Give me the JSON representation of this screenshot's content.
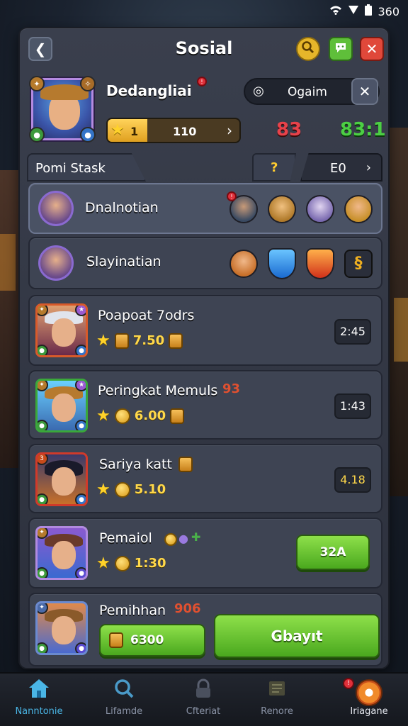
{
  "status_bar": {
    "time": "360",
    "wifi_icon": "wifi-icon",
    "signal_icon": "signal-icon",
    "battery_icon": "battery-icon"
  },
  "header": {
    "title": "Sosial",
    "back_icon": "back-arrow-icon",
    "search_icon": "search-icon",
    "chat_icon": "chat-icon",
    "close_icon": "close-icon"
  },
  "profile": {
    "name": "Dedangliai",
    "level": "1",
    "xp_value": "110",
    "xp_fraction": 0.3,
    "search_pill_text": "Ogaim",
    "stat_red": "83",
    "stat_green": "83:1"
  },
  "tabs": {
    "left": "Pomi Stask",
    "middle": "?",
    "right": "E0"
  },
  "group_rows": [
    {
      "name": "Dnalnotian"
    },
    {
      "name": "Slayinatian"
    }
  ],
  "cards": [
    {
      "name": "Poapoat 7odrs",
      "extra": "",
      "value": "7.50",
      "time": "2:45"
    },
    {
      "name": "Peringkat Memuls",
      "extra": "93",
      "value": "6.00",
      "time": "1:43"
    },
    {
      "name": "Sariya katt",
      "extra": "",
      "value": "5.10",
      "time": "4.18"
    },
    {
      "name": "Pemaiol",
      "extra": "",
      "value": "1:30",
      "button": "32A"
    },
    {
      "name": "Pemihhan",
      "extra": "906",
      "coin_button": "6300",
      "big_button": "Gbayıt"
    }
  ],
  "bottom_nav": [
    {
      "label": "Nanntonie",
      "icon": "home-icon",
      "active": true
    },
    {
      "label": "Lifamde",
      "icon": "search-icon",
      "active": false
    },
    {
      "label": "Cfteriat",
      "icon": "lock-icon",
      "active": false
    },
    {
      "label": "Renore",
      "icon": "map-icon",
      "active": false
    },
    {
      "label": "Iriagane",
      "icon": "target-icon",
      "active": false,
      "badge": "!"
    }
  ],
  "colors": {
    "accent_green": "#4aa81e",
    "accent_red": "#e0483a",
    "accent_gold": "#ffd22a",
    "nav_active": "#4ab6e6"
  }
}
